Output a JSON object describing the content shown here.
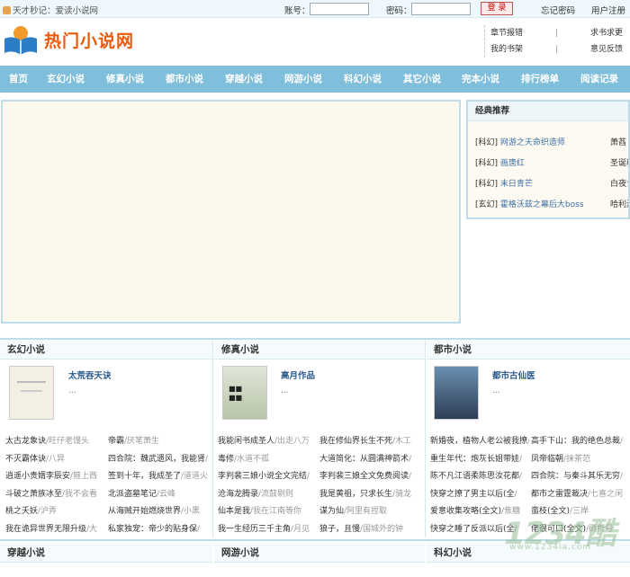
{
  "topbar": {
    "slogan": "天才秒记：爱读小说网",
    "account_label": "账号：",
    "password_label": "密码：",
    "login_button": "登 录",
    "forgot": "忘记密码",
    "register": "用户注册"
  },
  "header": {
    "logo_text": "热门小说网",
    "links": [
      [
        "章节报错",
        "求书求更"
      ],
      [
        "我的书架",
        "意见反馈"
      ]
    ],
    "sep": "|"
  },
  "nav": [
    "首页",
    "玄幻小说",
    "修真小说",
    "都市小说",
    "穿越小说",
    "网游小说",
    "科幻小说",
    "其它小说",
    "完本小说",
    "排行榜单",
    "阅读记录"
  ],
  "recommend": {
    "title": "经典推荐",
    "items": [
      {
        "cat": "[科幻]",
        "name": "网游之天命织造师",
        "author": "萧萏"
      },
      {
        "cat": "[科幻]",
        "name": "画唐红",
        "author": "圣诞稻草"
      },
      {
        "cat": "[科幻]",
        "name": "末日青芒",
        "author": "白夜食"
      },
      {
        "cat": "[玄幻]",
        "name": "霍格沃兹之幕后大boss",
        "author": "哈利波特"
      }
    ]
  },
  "sections": [
    {
      "title": "玄幻小说",
      "featured": {
        "name": "太荒吞天诀",
        "dots": "..."
      },
      "rows": [
        [
          [
            "太古龙象诀",
            "/旺仔老馒头"
          ],
          [
            "帝霸",
            "/厌笔萧生"
          ]
        ],
        [
          [
            "不灭霸体诀",
            "/八异"
          ],
          [
            "四合院：魏武遗风，我能肾",
            "/"
          ]
        ],
        [
          [
            "逍遥小贵婿李辰安",
            "/箍上西"
          ],
          [
            "签到十年，我成圣了",
            "/道道火"
          ]
        ],
        [
          [
            "斗破之萧族冰至",
            "/我不会看"
          ],
          [
            "北派盗墓笔记",
            "/云峰"
          ]
        ],
        [
          [
            "桃之夭妖",
            "/沪弄"
          ],
          [
            "从海贼开始燃烧世界",
            "/小黑"
          ]
        ],
        [
          [
            "我在诡异世界无限升级",
            "/大"
          ],
          [
            "私家独宠：帝少的贴身保",
            "/"
          ]
        ]
      ]
    },
    {
      "title": "修真小说",
      "featured": {
        "name": "高月作品",
        "dots": "..."
      },
      "rows": [
        [
          [
            "我能闲书成圣人",
            "/出走八万"
          ],
          [
            "我在修仙界长生不死",
            "/木工"
          ]
        ],
        [
          [
            "毒修",
            "/水道不孤"
          ],
          [
            "大道简化：从圆满神箭术",
            "/"
          ]
        ],
        [
          [
            "李判裴三娘小说全文完结",
            "/"
          ],
          [
            "李判裴三娘全文免费阅读",
            "/"
          ]
        ],
        [
          [
            "沧海龙腾录",
            "/流鼓剔则"
          ],
          [
            "我是黄祖，只求长生",
            "/骑龙"
          ]
        ],
        [
          [
            "仙本是我",
            "/我在江南等你"
          ],
          [
            "谋为仙",
            "/阿里有捏取"
          ]
        ],
        [
          [
            "我一生经历三千主角",
            "/月见"
          ],
          [
            "狼子，且慢",
            "/国城外的钟"
          ]
        ]
      ]
    },
    {
      "title": "都市小说",
      "featured": {
        "name": "都市古仙医",
        "dots": "..."
      },
      "rows": [
        [
          [
            "新婚夜，植物人老公被我撩",
            "/"
          ],
          [
            "高手下山：我的绝色总裁",
            "/"
          ]
        ],
        [
          [
            "重生年代：炮灰长姐带娃",
            "/"
          ],
          [
            "凤帝临朝",
            "/抹茶范"
          ]
        ],
        [
          [
            "陈不凡江语柔陈思汝花都",
            "/"
          ],
          [
            "四合院：与秦斗其乐无穷",
            "/"
          ]
        ],
        [
          [
            "快穿之撩了男主以后(全",
            "/"
          ],
          [
            "都市之雷霆裁决",
            "/七喜之闲"
          ]
        ],
        [
          [
            "爱意收集攻略(全文)",
            "/焦糖"
          ],
          [
            "蛮枝(全文)",
            "/三岸"
          ]
        ],
        [
          [
            "快穿之睡了反派以后(全",
            "/"
          ],
          [
            "佬很可口(全文)",
            "/硕析号"
          ]
        ]
      ]
    }
  ],
  "bottom_sections": [
    "穿越小说",
    "网游小说",
    "科幻小说"
  ],
  "watermark": {
    "big": "1234酷",
    "small": "www.1234la.com"
  }
}
